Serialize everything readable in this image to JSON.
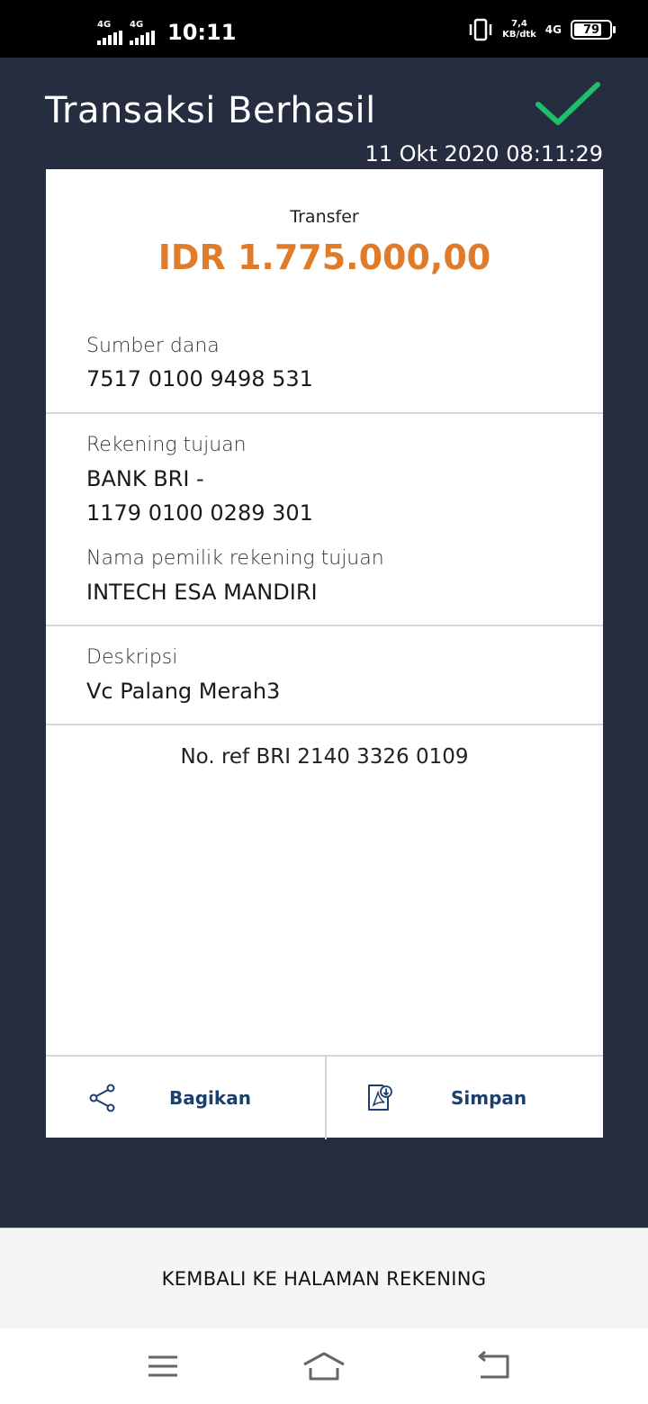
{
  "status_bar": {
    "network_1": "4G",
    "network_2": "4G",
    "time": "10:11",
    "speed_value": "7,4",
    "speed_unit": "KB/dtk",
    "network_right": "4G",
    "battery": "79"
  },
  "header": {
    "title": "Transaksi Berhasil",
    "datetime": "11 Okt 2020 08:11:29",
    "success_color": "#1fbf6a"
  },
  "receipt": {
    "type": "Transfer",
    "amount": "IDR 1.775.000,00",
    "source_label": "Sumber dana",
    "source_value": "7517 0100 9498 531",
    "dest_label": "Rekening tujuan",
    "dest_bank": "BANK BRI -",
    "dest_account": "1179 0100 0289 301",
    "owner_label": "Nama pemilik rekening tujuan",
    "owner_value": "INTECH ESA MANDIRI",
    "desc_label": "Deskripsi",
    "desc_value": "Vc Palang Merah3",
    "reference": "No. ref BRI 2140 3326 0109"
  },
  "actions": {
    "share_label": "Bagikan",
    "share_icon": "share-icon",
    "save_label": "Simpan",
    "save_icon": "pdf-download-icon"
  },
  "footer": {
    "back_label": "KEMBALI KE HALAMAN REKENING"
  },
  "colors": {
    "background": "#262d40",
    "amount": "#e07b2a",
    "action_text": "#1d3f6e"
  }
}
